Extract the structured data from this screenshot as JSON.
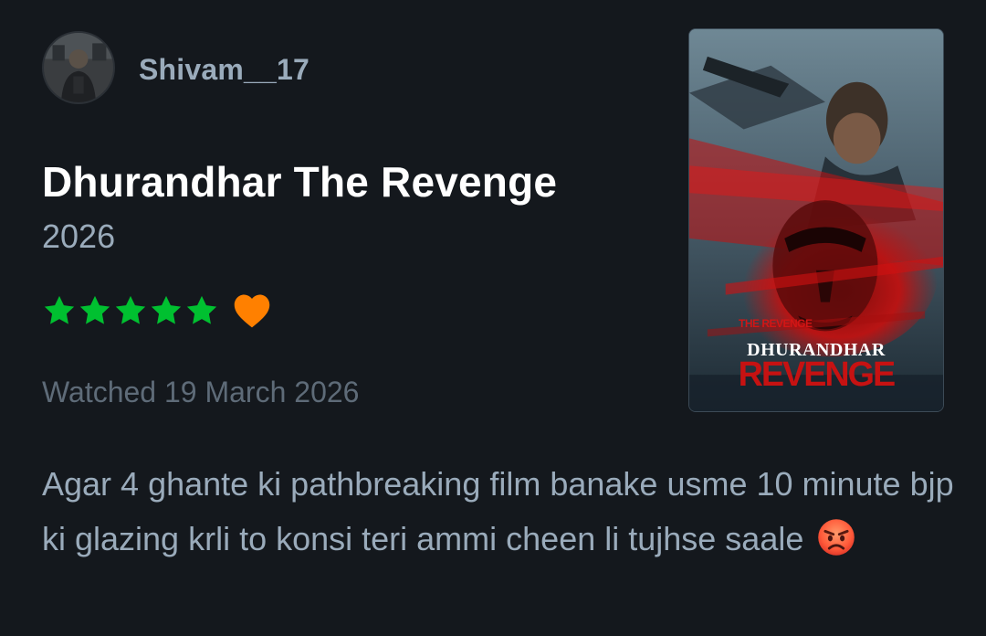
{
  "user": {
    "username": "Shivam__17"
  },
  "film": {
    "title": "Dhurandhar The Revenge",
    "year": "2026"
  },
  "rating": {
    "stars": 5,
    "max_stars": 5,
    "liked": true,
    "star_color": "#00c030",
    "heart_color": "#ff8000"
  },
  "watched": {
    "text": "Watched 19 March 2026"
  },
  "poster": {
    "caption": "DHURANDHAR",
    "tag": "THE REVENGE"
  },
  "review": {
    "text": "Agar 4 ghante ki pathbreaking film banake usme 10 minute bjp ki glazing krli to konsi teri ammi cheen li tujhse saale",
    "emoji": "angry-face-icon"
  },
  "colors": {
    "background": "#14181d",
    "muted_text": "#9aabbb",
    "faint_text": "#5e6b78"
  }
}
